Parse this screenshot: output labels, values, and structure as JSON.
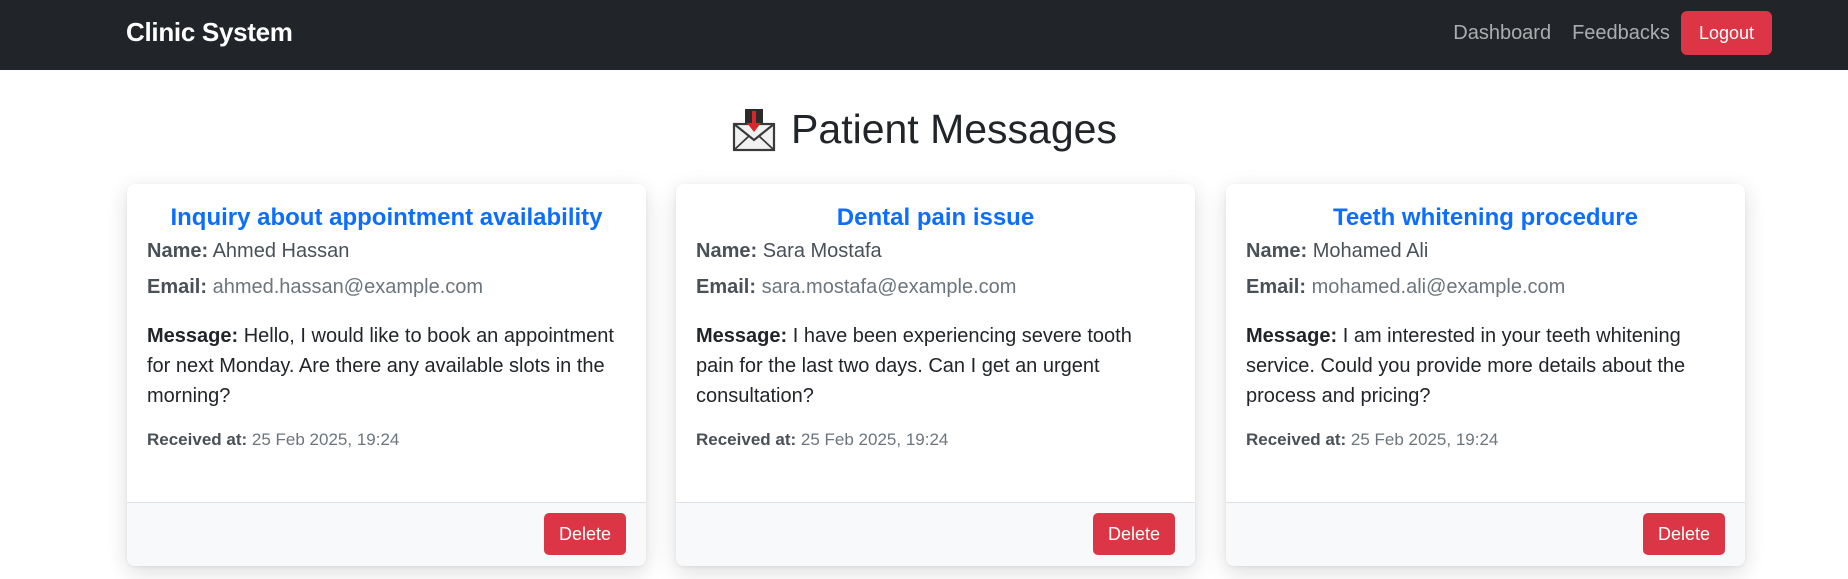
{
  "navbar": {
    "brand": "Clinic System",
    "links": [
      "Dashboard",
      "Feedbacks"
    ],
    "logout_label": "Logout"
  },
  "page": {
    "title": "Patient Messages",
    "title_icon": "envelope-with-arrow-icon"
  },
  "labels": {
    "name": "Name:",
    "email": "Email:",
    "message": "Message:",
    "received": "Received at:",
    "delete": "Delete"
  },
  "messages": [
    {
      "subject": "Inquiry about appointment availability",
      "name": "Ahmed Hassan",
      "email": "ahmed.hassan@example.com",
      "message": "Hello, I would like to book an appointment for next Monday. Are there any available slots in the morning?",
      "received": "25 Feb 2025, 19:24"
    },
    {
      "subject": "Dental pain issue",
      "name": "Sara Mostafa",
      "email": "sara.mostafa@example.com",
      "message": "I have been experiencing severe tooth pain for the last two days. Can I get an urgent consultation?",
      "received": "25 Feb 2025, 19:24"
    },
    {
      "subject": "Teeth whitening procedure",
      "name": "Mohamed Ali",
      "email": "mohamed.ali@example.com",
      "message": "I am interested in your teeth whitening service. Could you provide more details about the process and pricing?",
      "received": "25 Feb 2025, 19:24"
    }
  ],
  "colors": {
    "navbar_bg": "#212529",
    "danger": "#dc3545",
    "primary": "#0d6efd"
  }
}
